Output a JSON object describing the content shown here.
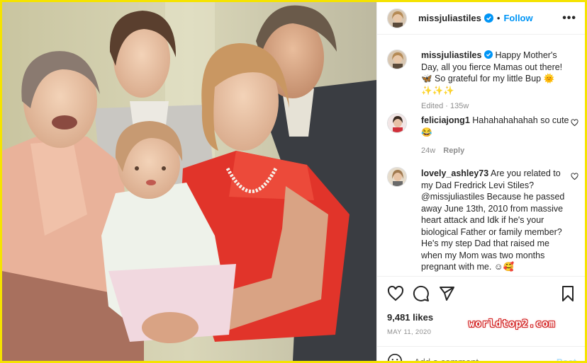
{
  "post": {
    "username": "missjuliastiles",
    "separator": "•",
    "follow_label": "Follow",
    "more_label": "•••"
  },
  "caption": {
    "username": "missjuliastiles",
    "text": "Happy Mother's Day, all you fierce Mamas out there! 🦋 So grateful for my little Bup 🌞✨✨✨",
    "edited": "Edited",
    "separator": "·",
    "age": "135w"
  },
  "comments": [
    {
      "username": "feliciajong1",
      "text": "Hahahahahahah so cute 😂",
      "age": "24w",
      "reply_label": "Reply"
    },
    {
      "username": "lovely_ashley73",
      "text": "Are you related to my Dad Fredrick Levi Stiles? @missjuliastiles Because he passed away June 13th, 2010 from massive heart attack and Idk if he's your biological Father or family member? He's my step Dad that raised me when my Mom was two months pregnant with me. ☺🥰"
    }
  ],
  "likes": "9,481 likes",
  "date": "MAY 11, 2020",
  "add_comment": {
    "placeholder": "Add a comment...",
    "post_label": "Post"
  },
  "watermark": "worldtop2.com",
  "colors": {
    "frame_border": "#f5e300",
    "link_blue": "#0095f6",
    "dress_red": "#e1342a"
  },
  "icons": [
    "verified-badge-icon",
    "heart-icon",
    "comment-icon",
    "share-icon",
    "bookmark-icon",
    "emoji-icon"
  ]
}
